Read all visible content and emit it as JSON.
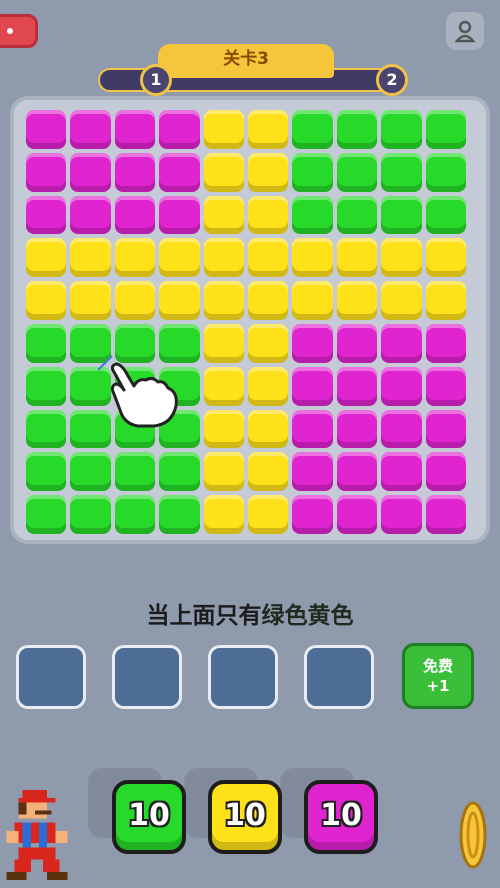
{
  "header": {
    "level_label": "关卡3",
    "progress_start": "1",
    "progress_end": "2"
  },
  "board": {
    "rows": [
      [
        "m",
        "m",
        "m",
        "m",
        "y",
        "y",
        "g",
        "g",
        "g",
        "g"
      ],
      [
        "m",
        "m",
        "m",
        "m",
        "y",
        "y",
        "g",
        "g",
        "g",
        "g"
      ],
      [
        "m",
        "m",
        "m",
        "m",
        "y",
        "y",
        "g",
        "g",
        "g",
        "g"
      ],
      [
        "y",
        "y",
        "y",
        "y",
        "y",
        "y",
        "y",
        "y",
        "y",
        "y"
      ],
      [
        "y",
        "y",
        "y",
        "y",
        "y",
        "y",
        "y",
        "y",
        "y",
        "y"
      ],
      [
        "g",
        "g",
        "g",
        "g",
        "y",
        "y",
        "m",
        "m",
        "m",
        "m"
      ],
      [
        "g",
        "g",
        "g",
        "g",
        "y",
        "y",
        "m",
        "m",
        "m",
        "m"
      ],
      [
        "g",
        "g",
        "g",
        "g",
        "y",
        "y",
        "m",
        "m",
        "m",
        "m"
      ],
      [
        "g",
        "g",
        "g",
        "g",
        "y",
        "y",
        "m",
        "m",
        "m",
        "m"
      ],
      [
        "g",
        "g",
        "g",
        "g",
        "y",
        "y",
        "m",
        "m",
        "m",
        "m"
      ]
    ],
    "colors": {
      "m": "#e024d0",
      "y": "#ffe11a",
      "g": "#27d929"
    }
  },
  "instruction": {
    "prefix": "当上面只有",
    "highlight": "绿色黄色"
  },
  "slots": [
    "",
    "",
    "",
    ""
  ],
  "free_button": {
    "line1": "免费",
    "line2": "+1"
  },
  "counters": [
    {
      "color": "green",
      "value": "10"
    },
    {
      "color": "yellow",
      "value": "10"
    },
    {
      "color": "magenta",
      "value": "10"
    }
  ],
  "icons": {
    "profile": "profile-icon",
    "hand": "pointing-hand-icon",
    "mascot": "pixel-mario-icon",
    "coin": "coin-icon"
  }
}
